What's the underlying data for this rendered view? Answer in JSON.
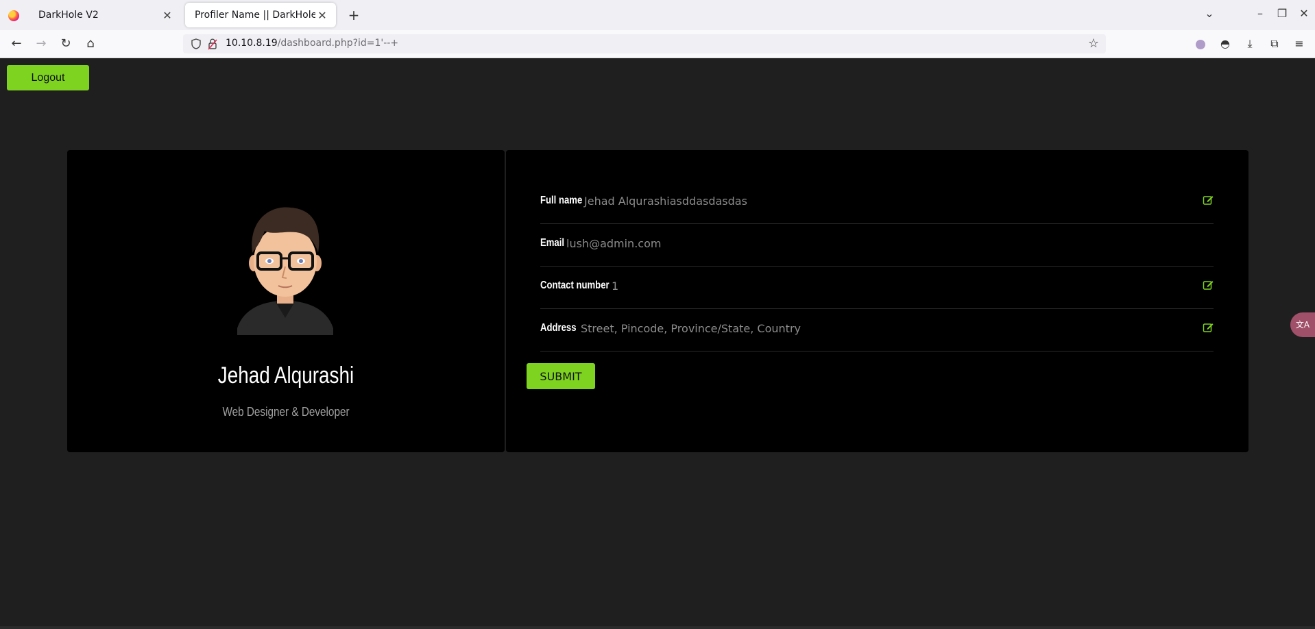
{
  "browser": {
    "tabs": [
      {
        "label": "DarkHole V2",
        "active": false
      },
      {
        "label": "Profiler Name || DarkHole",
        "active": true
      }
    ],
    "url": {
      "host": "10.10.8.19",
      "path": "/dashboard.php?id=1'--+"
    }
  },
  "header": {
    "logout_label": "Logout"
  },
  "profile": {
    "name": "Jehad Alqurashi",
    "role": "Web Designer & Developer"
  },
  "form": {
    "fields": [
      {
        "label": "Full name",
        "value": "Jehad Alqurashiasddasdasdas",
        "editable": true
      },
      {
        "label": "Email",
        "value": "lush@admin.com",
        "editable": false
      },
      {
        "label": "Contact number",
        "value": "1",
        "editable": true
      },
      {
        "label": "Address",
        "value": "Street, Pincode, Province/State, Country",
        "editable": true
      }
    ],
    "submit_label": "SUBMIT"
  },
  "colors": {
    "accent": "#7ed321",
    "page_bg": "#1f1f1f",
    "card_bg": "#000000"
  },
  "icons": {
    "edit": "edit-icon",
    "back": "back-arrow-icon",
    "forward": "forward-arrow-icon",
    "reload": "reload-icon",
    "home": "home-icon",
    "bookmark": "star-icon",
    "translate": "translate-icon"
  }
}
